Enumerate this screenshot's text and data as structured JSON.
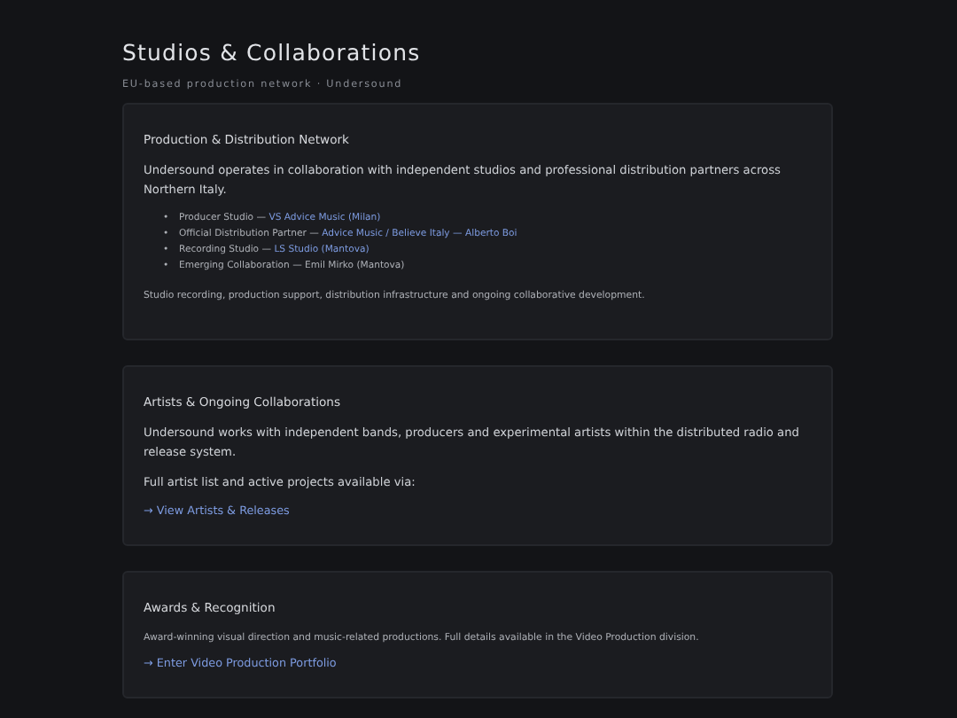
{
  "header": {
    "title": "Studios & Collaborations",
    "subtitle": "EU-based production network · Undersound"
  },
  "cards": [
    {
      "title": "Production & Distribution Network",
      "blocks": [
        {
          "kind": "text",
          "text": "Undersound operates in collaboration with independent studios and professional distribution partners across Northern Italy."
        },
        {
          "kind": "list",
          "items": [
            {
              "bullet": "•",
              "text": "Producer Studio — ",
              "link": "VS Advice Music (Milan)"
            },
            {
              "bullet": "•",
              "text": "Official Distribution Partner — ",
              "link": "Advice Music / Believe Italy — Alberto Boi"
            },
            {
              "bullet": "•",
              "text": "Recording Studio — ",
              "link": "LS Studio (Mantova)"
            },
            {
              "bullet": "•",
              "text": "Emerging Collaboration — Emil Mirko (Mantova)"
            }
          ]
        },
        {
          "kind": "note",
          "text": "Studio recording, production support, distribution infrastructure and ongoing collaborative development."
        }
      ]
    },
    {
      "title": "Artists & Ongoing Collaborations",
      "blocks": [
        {
          "kind": "text",
          "text": "Undersound works with independent bands, producers and experimental artists within the distributed radio and release system."
        },
        {
          "kind": "text",
          "text": "Full artist list and active projects available via:"
        },
        {
          "kind": "link",
          "text": "→ View Artists & Releases"
        }
      ]
    },
    {
      "title": "Awards & Recognition",
      "blocks": [
        {
          "kind": "note",
          "text": "Award-winning visual direction and music-related productions. Full details available in the Video Production division."
        },
        {
          "kind": "link",
          "text": "→ Enter Video Production Portfolio"
        }
      ]
    }
  ]
}
